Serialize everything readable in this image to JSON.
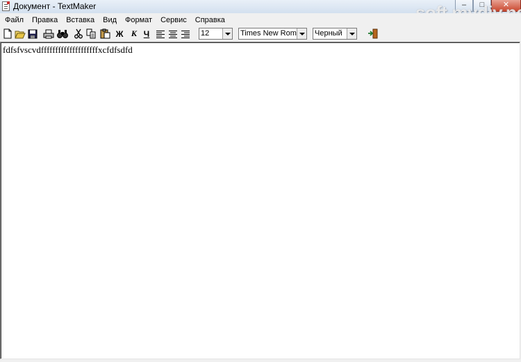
{
  "window": {
    "title": "Документ - TextMaker",
    "min_glyph": "–",
    "max_glyph": "□",
    "close_glyph": "✕",
    "watermark": "soft.mydiv.net"
  },
  "menu": {
    "items": [
      {
        "label": "Файл"
      },
      {
        "label": "Правка"
      },
      {
        "label": "Вставка"
      },
      {
        "label": "Вид"
      },
      {
        "label": "Формат"
      },
      {
        "label": "Сервис"
      },
      {
        "label": "Справка"
      }
    ]
  },
  "toolbar": {
    "buttons": [
      "new-icon",
      "open-icon",
      "save-icon",
      "print-icon",
      "find-icon",
      "cut-icon",
      "copy-icon",
      "paste-icon"
    ],
    "bold_label": "Ж",
    "italic_label": "К",
    "underline_label": "Ч",
    "align": [
      "align-left-icon",
      "align-center-icon",
      "align-right-icon"
    ],
    "font_size": "12",
    "font_name": "Times New Roman",
    "font_color": "Черный",
    "exit_icon": "exit-door-icon"
  },
  "document": {
    "text": "fdfsfvscvdffffffffffffffffffffxcfdfsdfd"
  },
  "colors": {
    "titlebar": "#d3e0ef",
    "close_button": "#c9472e",
    "background": "#f0f0f0",
    "document": "#ffffff"
  }
}
